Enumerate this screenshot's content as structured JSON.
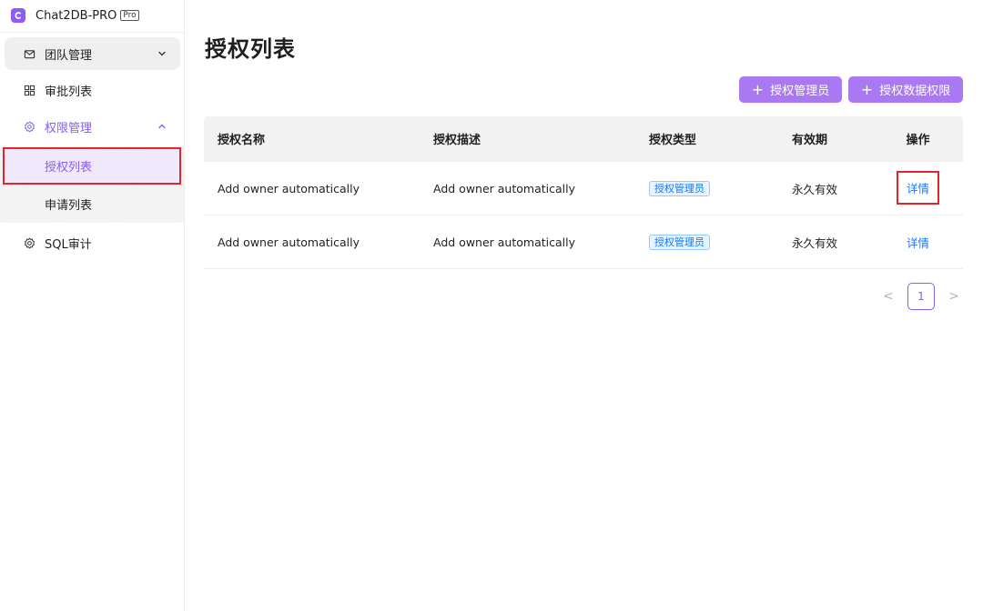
{
  "brand": {
    "name": "Chat2DB-PRO",
    "badge": "Pro",
    "logo_icon": "chat2db-logo-icon"
  },
  "sidebar": {
    "items": [
      {
        "label": "团队管理",
        "icon": "mail-icon",
        "expanded": false
      },
      {
        "label": "审批列表",
        "icon": "grid-icon"
      },
      {
        "label": "权限管理",
        "icon": "gear-icon",
        "expanded": true,
        "active": true,
        "children": [
          {
            "label": "授权列表",
            "selected": true
          },
          {
            "label": "申请列表"
          }
        ]
      },
      {
        "label": "SQL审计",
        "icon": "gear-icon"
      }
    ]
  },
  "main": {
    "title": "授权列表",
    "buttons": {
      "add_admin": "授权管理员",
      "add_data_perm": "授权数据权限"
    },
    "table": {
      "columns": [
        "授权名称",
        "授权描述",
        "授权类型",
        "有效期",
        "操作"
      ],
      "rows": [
        {
          "name": "Add owner automatically",
          "desc": "Add owner automatically",
          "type": "授权管理员",
          "validity": "永久有效",
          "action": "详情"
        },
        {
          "name": "Add owner automatically",
          "desc": "Add owner automatically",
          "type": "授权管理员",
          "validity": "永久有效",
          "action": "详情"
        }
      ]
    },
    "pagination": {
      "prev": "<",
      "current": "1",
      "next": ">"
    }
  },
  "colors": {
    "accent": "#8b5cf6",
    "button": "#a978f2",
    "link": "#1677ff",
    "highlight": "#e0262b"
  }
}
